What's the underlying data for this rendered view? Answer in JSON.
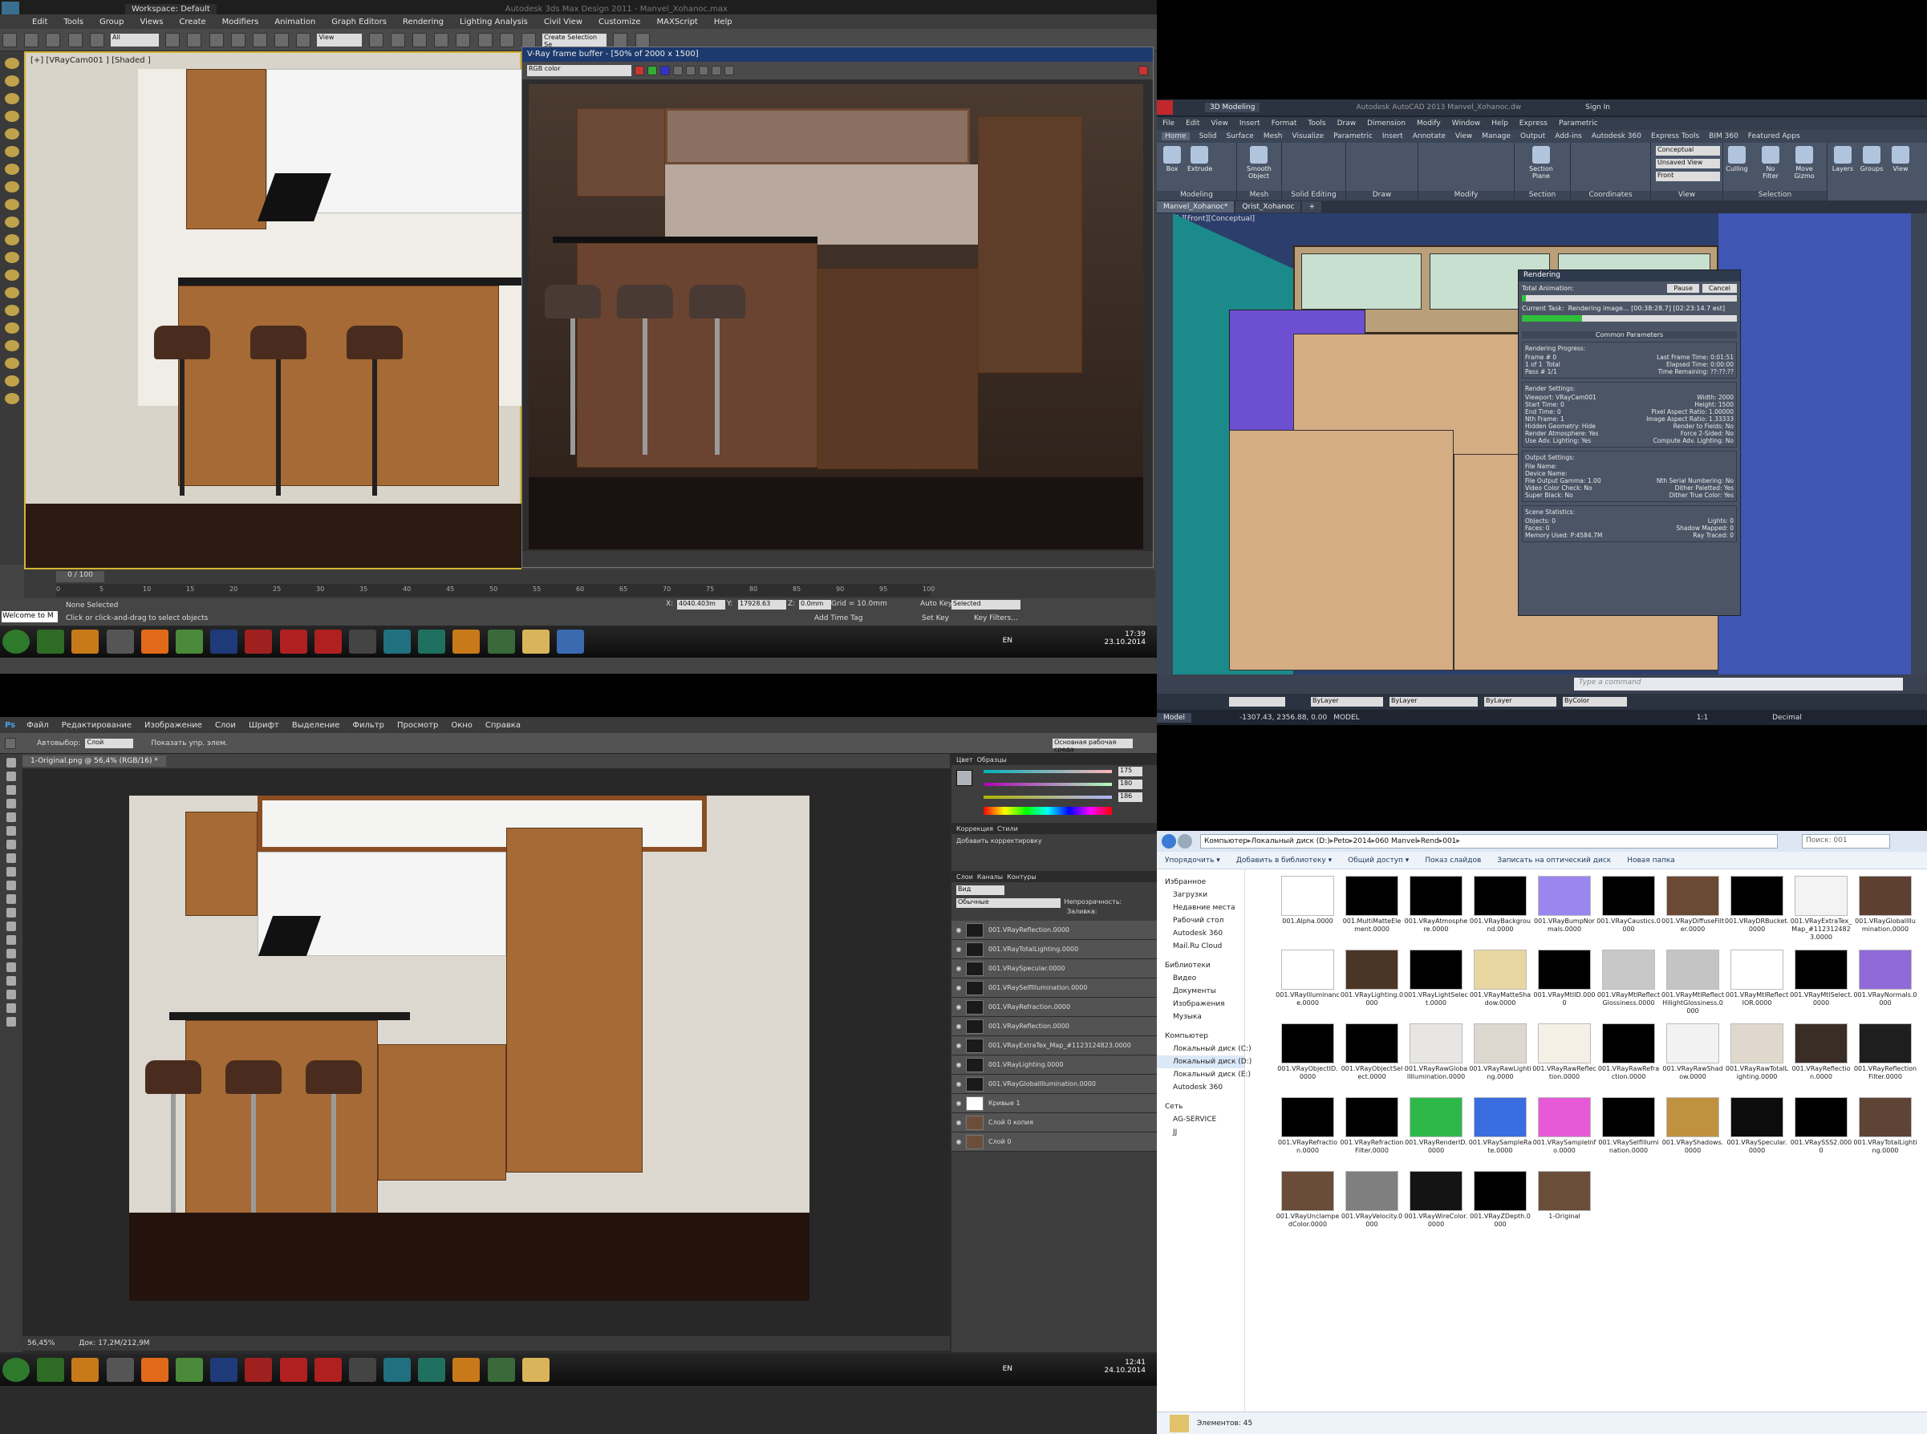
{
  "max": {
    "title": "Autodesk 3ds Max Design 2011 - Manvel_Xohanoc.max",
    "workspace": "Workspace: Default",
    "menu": [
      "Edit",
      "Tools",
      "Group",
      "Views",
      "Create",
      "Modifiers",
      "Animation",
      "Graph Editors",
      "Rendering",
      "Lighting Analysis",
      "Civil View",
      "Customize",
      "MAXScript",
      "Help"
    ],
    "selection_filter": "All",
    "view_dropdown": "View",
    "create_selection": "Create Selection Se",
    "viewport_label": "[+] [VRayCam001 ] [Shaded ]",
    "vfb_title": "V-Ray frame buffer - [50% of 2000 x 1500]",
    "vfb_channel": "RGB color",
    "timeline_pos": "0 / 100",
    "ticks": [
      "0",
      "5",
      "10",
      "15",
      "20",
      "25",
      "30",
      "35",
      "40",
      "45",
      "50",
      "55",
      "60",
      "65",
      "70",
      "75",
      "80",
      "85",
      "90",
      "95",
      "100"
    ],
    "selected_status": "None Selected",
    "hint": "Click or click-and-drag to select objects",
    "maxscript": "Welcome to M",
    "x": "4040.403m",
    "y": "17928.63",
    "z": "0.0mm",
    "grid": "Grid = 10.0mm",
    "autokey": "Auto Key",
    "setkey": "Set Key",
    "selected": "Selected",
    "keyfilters": "Key Filters...",
    "addtimetag": "Add Time Tag",
    "time": "17:39",
    "date": "23.10.2014",
    "lang": "EN"
  },
  "acad": {
    "title": "Autodesk AutoCAD 2013  Manvel_Xohanoc.dw",
    "workspace": "3D Modeling",
    "signin": "Sign In",
    "menu": [
      "File",
      "Edit",
      "View",
      "Insert",
      "Format",
      "Tools",
      "Draw",
      "Dimension",
      "Modify",
      "Window",
      "Help",
      "Express",
      "Parametric"
    ],
    "ribbon_tabs": [
      "Home",
      "Solid",
      "Surface",
      "Mesh",
      "Visualize",
      "Parametric",
      "Insert",
      "Annotate",
      "View",
      "Manage",
      "Output",
      "Add-ins",
      "Autodesk 360",
      "Express Tools",
      "BIM 360",
      "Featured Apps"
    ],
    "panels": [
      "Modeling",
      "Mesh",
      "Solid Editing",
      "Draw",
      "Modify",
      "Section",
      "Coordinates",
      "View",
      "Selection"
    ],
    "buttons": [
      "Box",
      "Extrude",
      "Smooth Object",
      "Section Plane",
      "Culling",
      "No Filter",
      "Move Gizmo",
      "Layers",
      "Groups",
      "View"
    ],
    "visual_style": "Conceptual",
    "saved_view": "Unsaved View",
    "front": "Front",
    "tabs": [
      "Manvel_Xohanoc*",
      "Qrist_Xohanoc"
    ],
    "viewport_label": "[-][Front][Conceptual]",
    "bylayer": "ByLayer",
    "bycolor": "ByColor",
    "coords": "-1307.43, 2356.88, 0.00",
    "model": "MODEL",
    "model_tab": "Model",
    "scale": "1:1",
    "units": "Decimal",
    "cmd_placeholder": "Type a command",
    "render": {
      "title": "Rendering",
      "total_anim": "Total Animation:",
      "pause": "Pause",
      "cancel": "Cancel",
      "current_task": "Current Task:",
      "rendering": "Rendering image...  [00:38:28.7] [02:23:14.7 est]",
      "common": "Common Parameters",
      "progress_hd": "Rendering Progress:",
      "frame": "Frame # 0",
      "of": "1 of 1",
      "total": "Total",
      "pass": "Pass # 1/1",
      "last_frame": "Last Frame Time: 0:01:51",
      "elapsed": "Elapsed Time: 0:00:00",
      "remaining": "Time Remaining: ??:??:??",
      "settings_hd": "Render Settings:",
      "settings": [
        [
          "Viewport: VRayCam001",
          "Width: 2000"
        ],
        [
          "Start Time: 0",
          "Height: 1500"
        ],
        [
          "End Time: 0",
          "Pixel Aspect Ratio: 1.00000"
        ],
        [
          "Nth Frame: 1",
          "Image Aspect Ratio: 1.33333"
        ],
        [
          "Hidden Geometry: Hide",
          "Render to Fields: No"
        ],
        [
          "Render Atmosphere: Yes",
          "Force 2-Sided: No"
        ],
        [
          "Use Adv. Lighting: Yes",
          "Compute Adv. Lighting: No"
        ]
      ],
      "output_hd": "Output Settings:",
      "output": [
        [
          "File Name:",
          ""
        ],
        [
          "Device Name:",
          ""
        ],
        [
          "File Output Gamma: 1.00",
          "Nth Serial Numbering: No"
        ],
        [
          "Video Color Check: No",
          "Dither Paletted: Yes"
        ],
        [
          "Super Black: No",
          "Dither True Color: Yes"
        ]
      ],
      "stats_hd": "Scene Statistics:",
      "stats": [
        [
          "Objects: 0",
          "Lights: 0"
        ],
        [
          "Faces: 0",
          "Shadow Mapped: 0"
        ],
        [
          "Memory Used: P:4584.7M",
          "Ray Traced: 0"
        ]
      ],
      "progress1": 0.02,
      "progress2": 0.28
    }
  },
  "ps": {
    "menu": [
      "Файл",
      "Редактирование",
      "Изображение",
      "Слои",
      "Шрифт",
      "Выделение",
      "Фильтр",
      "Просмотр",
      "Окно",
      "Справка"
    ],
    "autoselect": "Автовыбор:",
    "autoselect_value": "Слой",
    "show_controls": "Показать упр. элем.",
    "workspace": "Основная рабочая среда",
    "doc_tab": "1-Original.png @ 56,4% (RGB/16) *",
    "zoom": "56,45%",
    "docsize": "Док: 17,2M/212,9M",
    "color_tabs": [
      "Цвет",
      "Образцы"
    ],
    "r": "175",
    "g": "180",
    "b": "186",
    "corr_tabs": [
      "Коррекция",
      "Стили"
    ],
    "add_corr": "Добавить корректировку",
    "layer_tabs": [
      "Слои",
      "Каналы",
      "Контуры"
    ],
    "kind": "Вид",
    "blend": "Обычные",
    "opacity": "Непрозрачность:",
    "fill": "Заливка:",
    "layers": [
      "001.VRayReflection.0000",
      "001.VRayTotalLighting.0000",
      "001.VRaySpecular.0000",
      "001.VRaySelfIllumination.0000",
      "001.VRayRefraction.0000",
      "001.VRayReflection.0000",
      "001.VRayExtraTex_Map_#1123124823.0000",
      "001.VRayLighting.0000",
      "001.VRayGlobalIllumination.0000",
      "Кривые 1",
      "Слой 0 копия",
      "Слой 0"
    ],
    "time": "12:41",
    "date": "24.10.2014",
    "lang": "EN"
  },
  "exp": {
    "path": [
      "Компьютер",
      "Локальный диск (D:)",
      "Peto",
      "2014",
      "060 Manvel",
      "Rend",
      "001"
    ],
    "search": "Поиск: 001",
    "commands": [
      "Упорядочить ▾",
      "Добавить в библиотеку ▾",
      "Общий доступ ▾",
      "Показ слайдов",
      "Записать на оптический диск",
      "Новая папка"
    ],
    "nav": [
      {
        "t": "Избранное",
        "h": true
      },
      {
        "t": "Загрузки"
      },
      {
        "t": "Недавние места"
      },
      {
        "t": "Рабочий стол"
      },
      {
        "t": "Autodesk 360"
      },
      {
        "t": "Mail.Ru Cloud"
      },
      {
        "t": "Библиотеки",
        "h": true
      },
      {
        "t": "Видео"
      },
      {
        "t": "Документы"
      },
      {
        "t": "Изображения"
      },
      {
        "t": "Музыка"
      },
      {
        "t": "Компьютер",
        "h": true
      },
      {
        "t": "Локальный диск (C:)"
      },
      {
        "t": "Локальный диск (D:)",
        "sel": true
      },
      {
        "t": "Локальный диск (E:)"
      },
      {
        "t": "Autodesk 360"
      },
      {
        "t": "Сеть",
        "h": true
      },
      {
        "t": "AG-SERVICE"
      },
      {
        "t": "JJ"
      }
    ],
    "files": [
      {
        "n": "001.Alpha.0000",
        "c": "#ffffff"
      },
      {
        "n": "001.MultiMatteElement.0000",
        "c": "#000000"
      },
      {
        "n": "001.VRayAtmosphere.0000",
        "c": "#000000"
      },
      {
        "n": "001.VRayBackground.0000",
        "c": "#000000"
      },
      {
        "n": "001.VRayBumpNormals.0000",
        "c": "#9b86f0"
      },
      {
        "n": "001.VRayCaustics.0000",
        "c": "#000000"
      },
      {
        "n": "001.VRayDiffuseFilter.0000",
        "c": "#6b4a33"
      },
      {
        "n": "001.VRayDRBucket.0000",
        "c": "#000000"
      },
      {
        "n": "001.VRayExtraTex_Map_#1123124823.0000",
        "c": "#f3f3f3"
      },
      {
        "n": "001.VRayGlobalIllumination.0000",
        "c": "#5d4030"
      },
      {
        "n": "001.VRayIlluminance.0000",
        "c": "#ffffff"
      },
      {
        "n": "001.VRayLighting.0000",
        "c": "#4b3626"
      },
      {
        "n": "001.VRayLightSelect.0000",
        "c": "#000000"
      },
      {
        "n": "001.VRayMatteShadow.0000",
        "c": "#e8d6a0"
      },
      {
        "n": "001.VRayMtlID.0000",
        "c": "#000000"
      },
      {
        "n": "001.VRayMtlReflectGlossiness.0000",
        "c": "#c8c8c8"
      },
      {
        "n": "001.VRayMtlReflectHilightGlossiness.0000",
        "c": "#c4c4c4"
      },
      {
        "n": "001.VRayMtlReflectIOR.0000",
        "c": "#ffffff"
      },
      {
        "n": "001.VRayMtlSelect.0000",
        "c": "#000000"
      },
      {
        "n": "001.VRayNormals.0000",
        "c": "#8f6ad8"
      },
      {
        "n": "001.VRayObjectID.0000",
        "c": "#000000"
      },
      {
        "n": "001.VRayObjectSelect.0000",
        "c": "#000000"
      },
      {
        "n": "001.VRayRawGlobalIllumination.0000",
        "c": "#e8e6e2"
      },
      {
        "n": "001.VRayRawLighting.0000",
        "c": "#dcd8d0"
      },
      {
        "n": "001.VRayRawReflection.0000",
        "c": "#f4f0e6"
      },
      {
        "n": "001.VRayRawRefraction.0000",
        "c": "#000000"
      },
      {
        "n": "001.VRayRawShadow.0000",
        "c": "#f2f2f2"
      },
      {
        "n": "001.VRayRawTotalLighting.0000",
        "c": "#e0d8cc"
      },
      {
        "n": "001.VRayReflection.0000",
        "c": "#3a2d26"
      },
      {
        "n": "001.VRayReflectionFilter.0000",
        "c": "#1e1e1e"
      },
      {
        "n": "001.VRayRefraction.0000",
        "c": "#000000"
      },
      {
        "n": "001.VRayRefractionFilter.0000",
        "c": "#000000"
      },
      {
        "n": "001.VRayRenderID.0000",
        "c": "#2eb84a"
      },
      {
        "n": "001.VRaySampleRate.0000",
        "c": "#3a6de0"
      },
      {
        "n": "001.VRaySampleInfo.0000",
        "c": "#e65ad7"
      },
      {
        "n": "001.VRaySelfIllumination.0000",
        "c": "#000000"
      },
      {
        "n": "001.VRayShadows.0000",
        "c": "#c0913f"
      },
      {
        "n": "001.VRaySpecular.0000",
        "c": "#0c0c0c"
      },
      {
        "n": "001.VRaySSS2.0000",
        "c": "#000000"
      },
      {
        "n": "001.VRayTotalLighting.0000",
        "c": "#5e4434"
      },
      {
        "n": "001.VRayUnclampedColor.0000",
        "c": "#6a4c38"
      },
      {
        "n": "001.VRayVelocity.0000",
        "c": "#7f7f7f"
      },
      {
        "n": "001.VRayWireColor.0000",
        "c": "#141414"
      },
      {
        "n": "001.VRayZDepth.0000",
        "c": "#000000"
      },
      {
        "n": "1-Original",
        "c": "#6b4e3a"
      }
    ],
    "count": "Элементов: 45"
  }
}
